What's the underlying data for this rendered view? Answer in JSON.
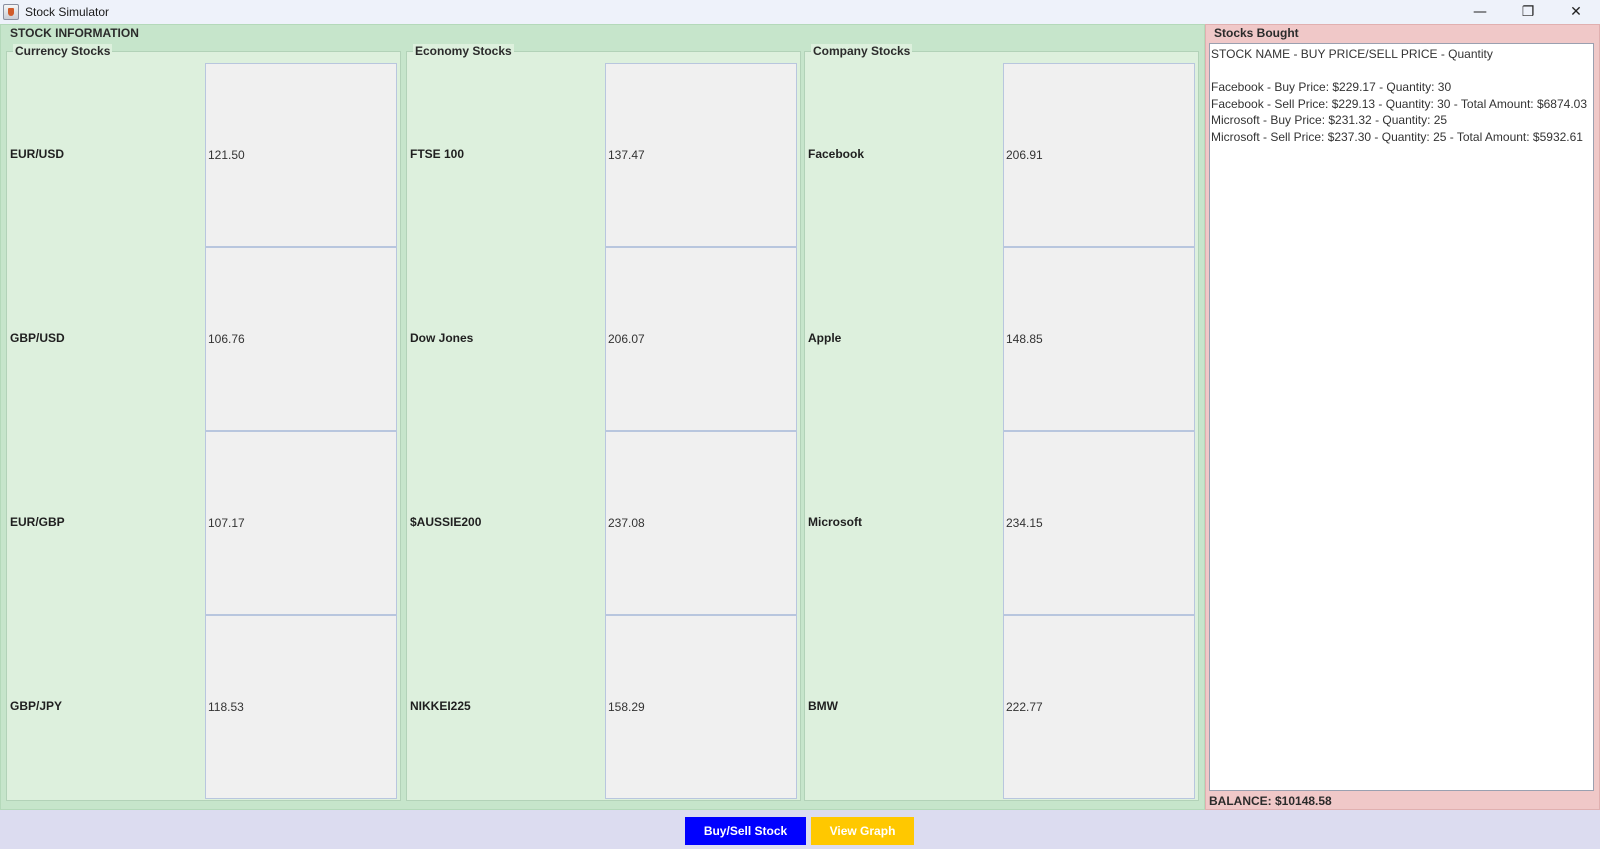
{
  "window": {
    "title": "Stock Simulator",
    "minimize_glyph": "—",
    "maximize_glyph": "❐",
    "close_glyph": "✕"
  },
  "stock_info": {
    "title": "STOCK INFORMATION",
    "categories": [
      {
        "title": "Currency Stocks",
        "stocks": [
          {
            "name": "EUR/USD",
            "value": "121.50"
          },
          {
            "name": "GBP/USD",
            "value": "106.76"
          },
          {
            "name": "EUR/GBP",
            "value": "107.17"
          },
          {
            "name": "GBP/JPY",
            "value": "118.53"
          }
        ]
      },
      {
        "title": "Economy Stocks",
        "stocks": [
          {
            "name": "FTSE 100",
            "value": "137.47"
          },
          {
            "name": "Dow Jones",
            "value": "206.07"
          },
          {
            "name": "$AUSSIE200",
            "value": "237.08"
          },
          {
            "name": "NIKKEI225",
            "value": "158.29"
          }
        ]
      },
      {
        "title": "Company Stocks",
        "stocks": [
          {
            "name": "Facebook",
            "value": "206.91"
          },
          {
            "name": "Apple",
            "value": "148.85"
          },
          {
            "name": "Microsoft",
            "value": "234.15"
          },
          {
            "name": "BMW",
            "value": "222.77"
          }
        ]
      }
    ]
  },
  "stocks_bought": {
    "title": "Stocks Bought",
    "lines": [
      "STOCK NAME - BUY PRICE/SELL PRICE - Quantity",
      "",
      "Facebook - Buy Price: $229.17 - Quantity: 30",
      "Facebook - Sell Price: $229.13 - Quantity: 30 - Total Amount: $6874.03",
      "Microsoft - Buy Price: $231.32 - Quantity: 25",
      "Microsoft - Sell Price: $237.30 - Quantity: 25 - Total Amount: $5932.61"
    ],
    "balance": "BALANCE: $10148.58"
  },
  "buttons": {
    "buy_sell": "Buy/Sell Stock",
    "view_graph": "View Graph"
  },
  "colors": {
    "stock_panel_bg": "#c6e5cb",
    "category_bg": "#ddf0dd",
    "bought_panel_bg": "#f0c8c8",
    "buy_button_bg": "#0000ff",
    "graph_button_bg": "#ffc800"
  }
}
